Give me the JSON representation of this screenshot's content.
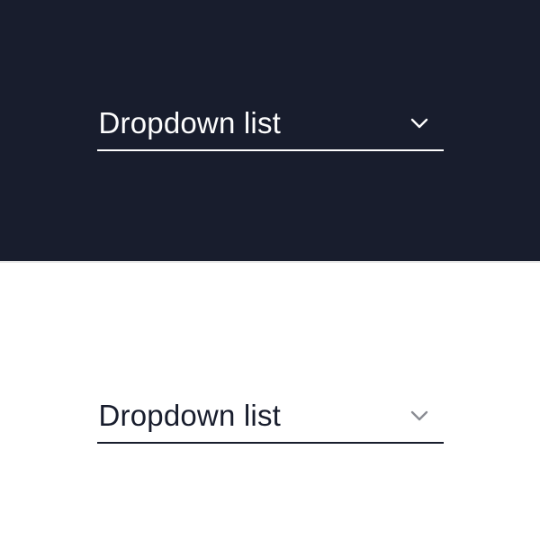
{
  "dark": {
    "label": "Dropdown list",
    "bg": "#181d2d",
    "fg": "#fdfdfd"
  },
  "light": {
    "label": "Dropdown list",
    "bg": "#ffffff",
    "fg": "#181d2d",
    "chevron_color": "#8a8c93"
  }
}
